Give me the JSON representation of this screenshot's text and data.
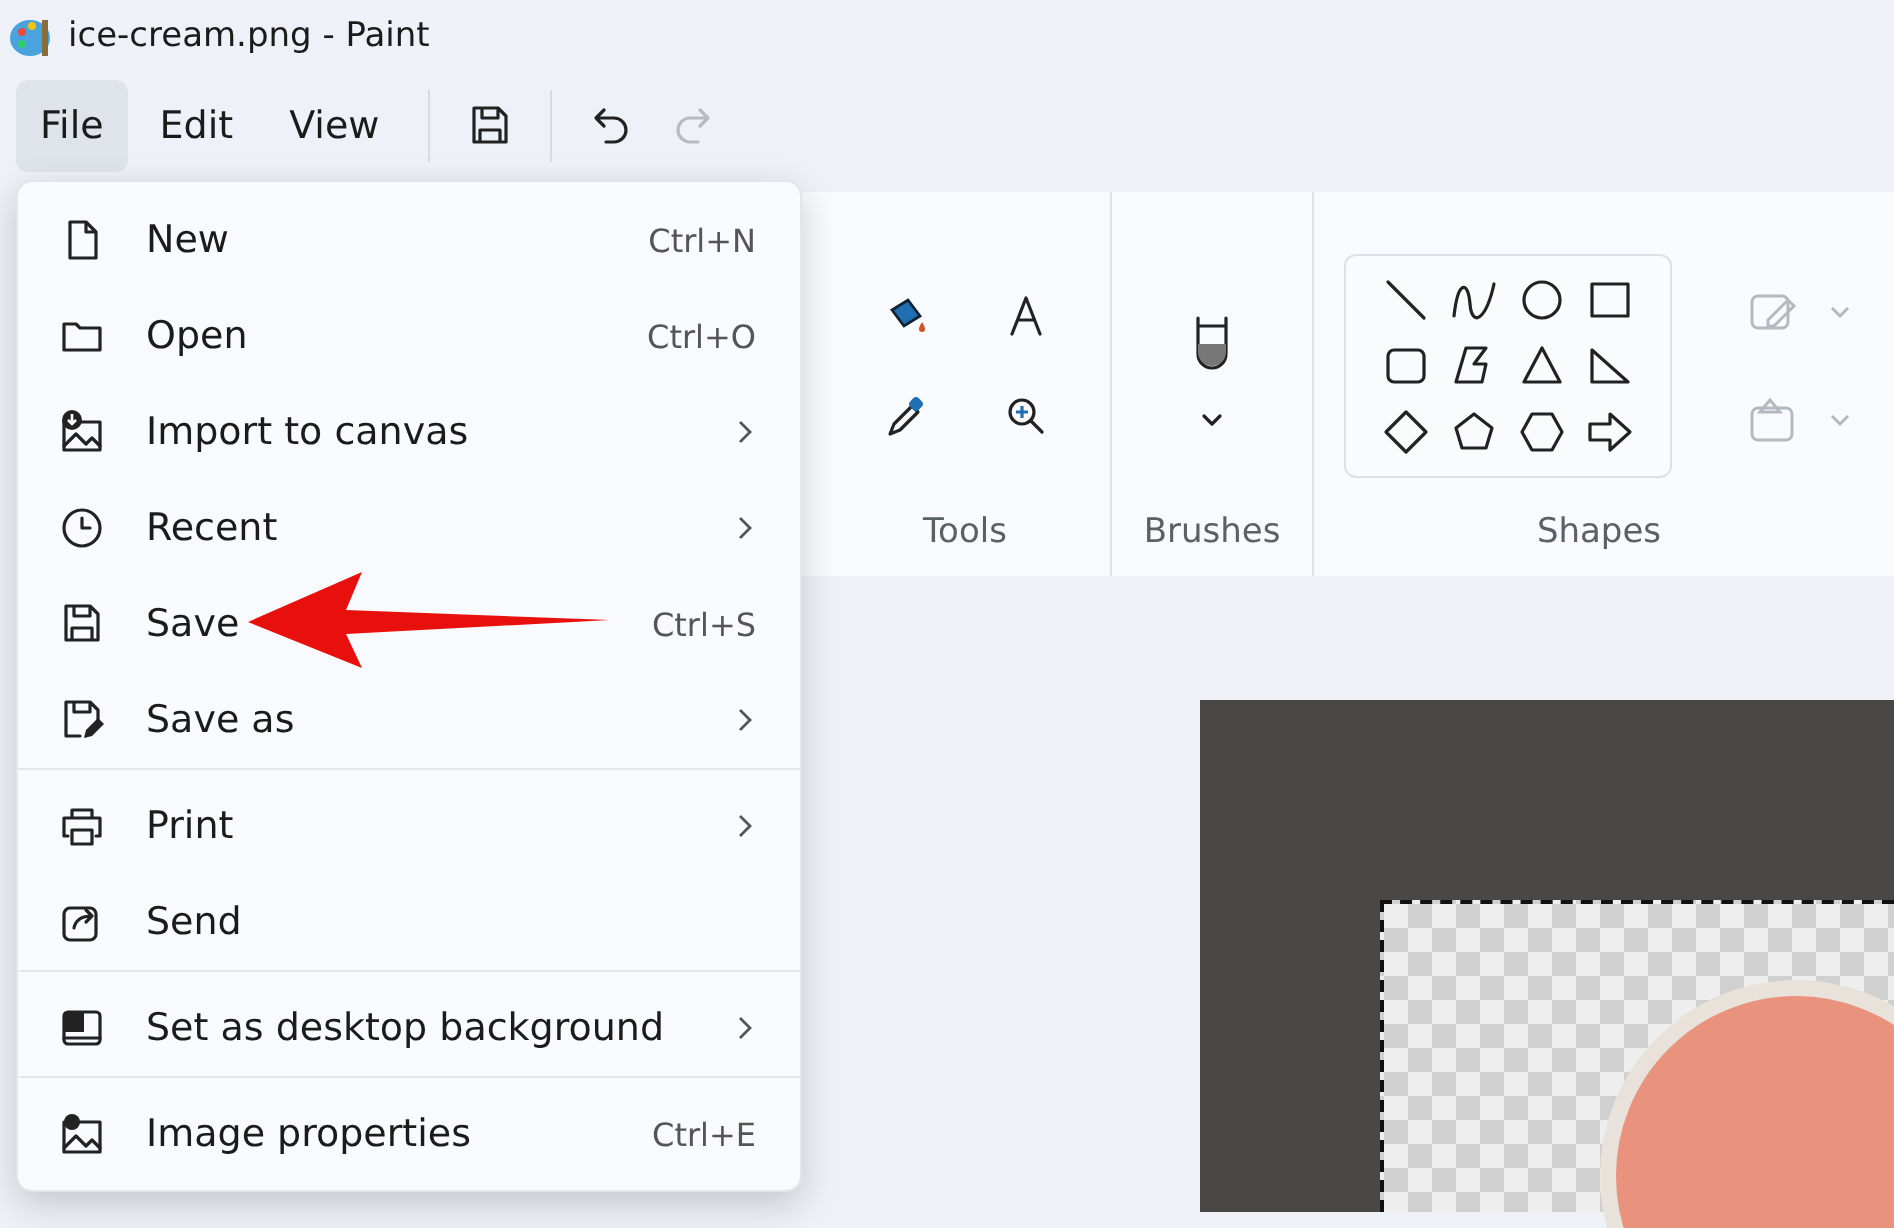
{
  "window": {
    "title": "ice-cream.png - Paint"
  },
  "menu_bar": [
    {
      "label": "File",
      "selected": true
    },
    {
      "label": "Edit",
      "selected": false
    },
    {
      "label": "View",
      "selected": false
    }
  ],
  "quick_access": [
    {
      "kind": "save",
      "disabled": false
    },
    {
      "kind": "undo",
      "disabled": false
    },
    {
      "kind": "redo",
      "disabled": true
    }
  ],
  "ribbon": {
    "groups": [
      {
        "kind": "tools",
        "label": "Tools"
      },
      {
        "kind": "brushes",
        "label": "Brushes"
      },
      {
        "kind": "shapes",
        "label": "Shapes"
      }
    ]
  },
  "file_menu": {
    "items": [
      {
        "kind": "new",
        "label": "New",
        "shortcut": "Ctrl+N",
        "submenu": false,
        "separator_after": false
      },
      {
        "kind": "open",
        "label": "Open",
        "shortcut": "Ctrl+O",
        "submenu": false,
        "separator_after": false
      },
      {
        "kind": "import",
        "label": "Import to canvas",
        "submenu": true,
        "separator_after": false
      },
      {
        "kind": "recent",
        "label": "Recent",
        "submenu": true,
        "separator_after": false
      },
      {
        "kind": "save",
        "label": "Save",
        "shortcut": "Ctrl+S",
        "submenu": false,
        "separator_after": false
      },
      {
        "kind": "saveas",
        "label": "Save as",
        "submenu": true,
        "separator_after": true
      },
      {
        "kind": "print",
        "label": "Print",
        "submenu": true,
        "separator_after": false
      },
      {
        "kind": "send",
        "label": "Send",
        "submenu": false,
        "separator_after": true
      },
      {
        "kind": "background",
        "label": "Set as desktop background",
        "submenu": true,
        "separator_after": true
      },
      {
        "kind": "properties",
        "label": "Image properties",
        "shortcut": "Ctrl+E",
        "submenu": false,
        "separator_after": false
      }
    ]
  }
}
